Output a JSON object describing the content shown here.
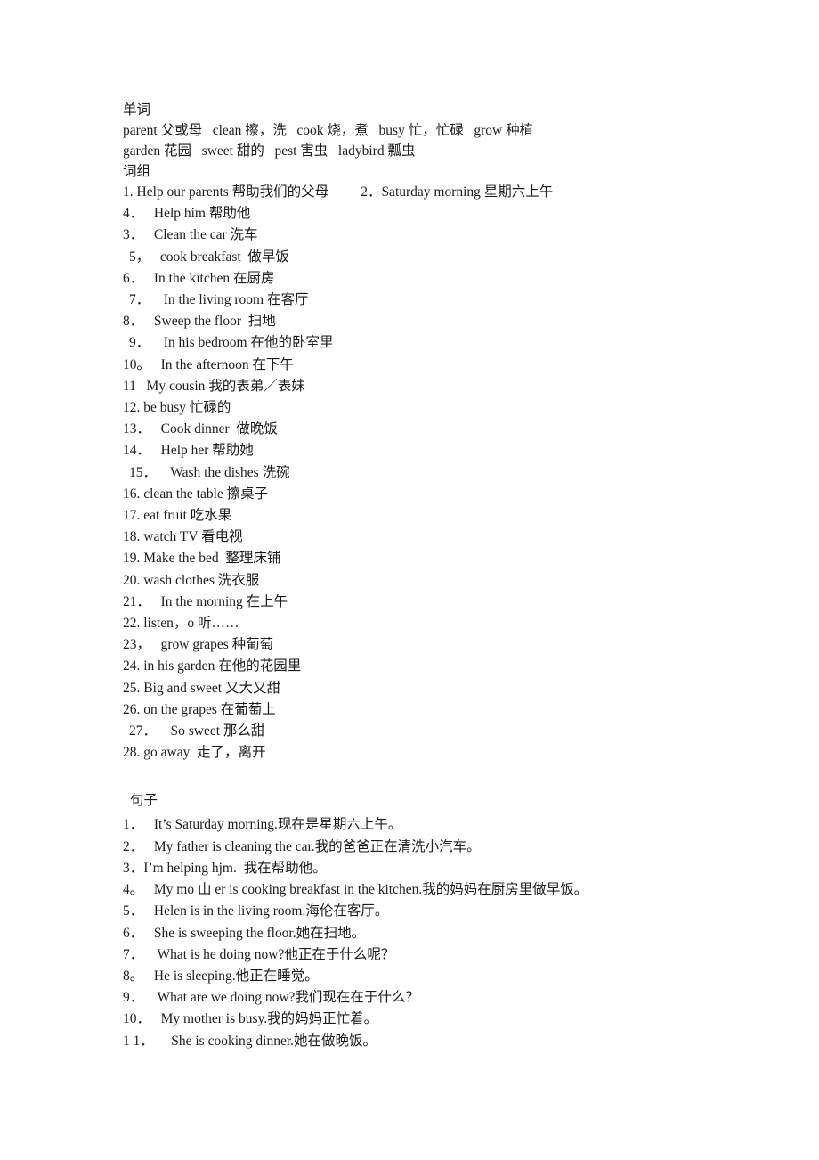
{
  "document": {
    "sections": {
      "words_label": "单词",
      "phrases_label": "词组",
      "sentences_label": "句子"
    },
    "word_lines": [
      "parent 父或母   clean 擦，洗   cook 烧，煮   busy 忙，忙碌   grow 种植",
      "garden 花园   sweet 甜的   pest 害虫   ladybird 瓢虫"
    ],
    "phrases": [
      {
        "indent": 0,
        "text": "1. Help our parents 帮助我们的父母"
      },
      {
        "indent": 0,
        "text": "2．Saturday morning 星期六上午",
        "column": "right"
      },
      {
        "indent": 0,
        "text": "4．   Help him 帮助他"
      },
      {
        "indent": 0,
        "text": "3．   Clean the car 洗车"
      },
      {
        "indent": 7,
        "text": "5，   cook breakfast  做早饭"
      },
      {
        "indent": 0,
        "text": "6．   In the kitchen 在厨房"
      },
      {
        "indent": 7,
        "text": "7．    In the living room 在客厅"
      },
      {
        "indent": 0,
        "text": "8．   Sweep the floor  扫地"
      },
      {
        "indent": 7,
        "text": "9．    In his bedroom 在他的卧室里"
      },
      {
        "indent": 0,
        "text": "10。   In the afternoon 在下午"
      },
      {
        "indent": 0,
        "text": "11   My cousin 我的表弟／表妹"
      },
      {
        "indent": 0,
        "text": "12. be busy 忙碌的"
      },
      {
        "indent": 0,
        "text": "13．   Cook dinner  做晚饭"
      },
      {
        "indent": 0,
        "text": "14．   Help her 帮助她"
      },
      {
        "indent": 7,
        "text": "15．    Wash the dishes 洗碗"
      },
      {
        "indent": 0,
        "text": "16. clean the table 擦桌子"
      },
      {
        "indent": 0,
        "text": "17. eat fruit 吃水果"
      },
      {
        "indent": 0,
        "text": "18. watch TV 看电视"
      },
      {
        "indent": 0,
        "text": "19. Make the bed  整理床铺"
      },
      {
        "indent": 0,
        "text": "20. wash clothes 洗衣服"
      },
      {
        "indent": 0,
        "text": "21．   In the morning 在上午"
      },
      {
        "indent": 0,
        "text": "22. listen，o 听……"
      },
      {
        "indent": 0,
        "text": "23，   grow grapes 种葡萄"
      },
      {
        "indent": 0,
        "text": "24. in his garden 在他的花园里"
      },
      {
        "indent": 0,
        "text": "25. Big and sweet 又大又甜"
      },
      {
        "indent": 0,
        "text": "26. on the grapes 在葡萄上"
      },
      {
        "indent": 7,
        "text": "27．    So sweet 那么甜"
      },
      {
        "indent": 0,
        "text": "28. go away  走了，离开"
      }
    ],
    "sentences": [
      {
        "indent": 0,
        "text": "1．   It’s Saturday morning.现在是星期六上午。"
      },
      {
        "indent": 0,
        "text": "2．   My father is cleaning the car.我的爸爸正在清洗小汽车。"
      },
      {
        "indent": 0,
        "text": "3．I’m helping hjm.  我在帮助他。"
      },
      {
        "indent": 0,
        "text": "4。   My mo 山 er is cooking breakfast in the kitchen.我的妈妈在厨房里做早饭。"
      },
      {
        "indent": 0,
        "text": "5．   Helen is in the living room.海伦在客厅。"
      },
      {
        "indent": 0,
        "text": "6．   She is sweeping the floor.她在扫地。"
      },
      {
        "indent": 0,
        "text": "7．    What is he doing now?他正在于什么呢？"
      },
      {
        "indent": 0,
        "text": "8。   He is sleeping.他正在睡觉。"
      },
      {
        "indent": 0,
        "text": "9．    What are we doing now?我们现在在于什么？"
      },
      {
        "indent": 0,
        "text": "10．   My mother is busy.我的妈妈正忙着。"
      },
      {
        "indent": 0,
        "text": "1 1．     She is cooking dinner.她在做晚饭。"
      }
    ]
  }
}
